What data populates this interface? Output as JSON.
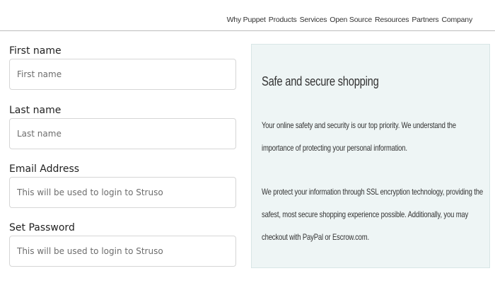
{
  "nav": {
    "items": [
      "Why Puppet",
      "Products",
      "Services",
      "Open Source",
      "Resources",
      "Partners",
      "Company"
    ]
  },
  "form": {
    "first_name": {
      "label": "First name",
      "placeholder": "First name",
      "value": ""
    },
    "last_name": {
      "label": "Last name",
      "placeholder": "Last name",
      "value": ""
    },
    "email": {
      "label": "Email Address",
      "placeholder": "This will be used to login to Struso",
      "value": ""
    },
    "password": {
      "label": "Set Password",
      "placeholder": "This will be used to login to Struso",
      "value": ""
    }
  },
  "info": {
    "title": "Safe and secure shopping",
    "paragraph1": "Your online safety and security is our top priority. We understand the importance of protecting your personal information.",
    "paragraph2": "We protect your information through SSL encryption technology, providing the safest, most secure shopping experience possible. Additionally, you may checkout with PayPal or Escrow.com."
  },
  "colors": {
    "panel_background": "#eef5f5",
    "input_border": "#d6d6d6"
  }
}
